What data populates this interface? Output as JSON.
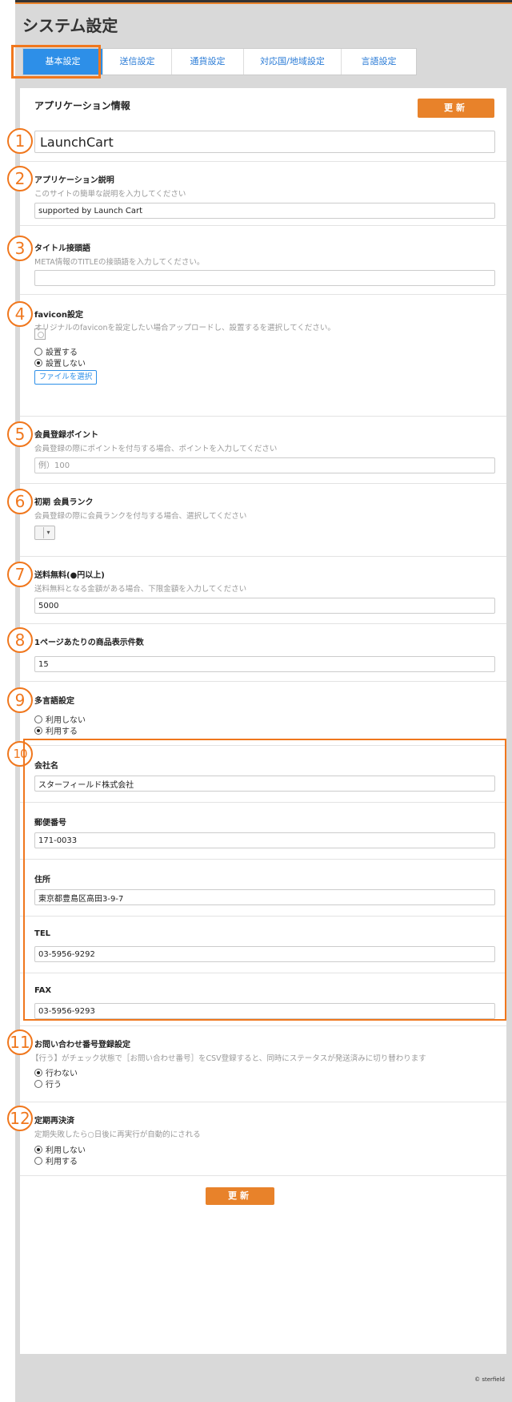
{
  "page_title": "システム設定",
  "tabs": [
    {
      "label": "基本設定",
      "active": true
    },
    {
      "label": "送信設定"
    },
    {
      "label": "通貨設定"
    },
    {
      "label": "対応国/地域設定"
    },
    {
      "label": "言語設定"
    }
  ],
  "panel_title": "アプリケーション情報",
  "update_label": "更新",
  "markers": [
    "1",
    "2",
    "3",
    "4",
    "5",
    "6",
    "7",
    "8",
    "9",
    "10",
    "11",
    "12"
  ],
  "fields": {
    "app_name": {
      "value": "LaunchCart"
    },
    "app_desc": {
      "label": "アプリケーション説明",
      "help": "このサイトの簡単な説明を入力してください",
      "value": "supported by Launch Cart"
    },
    "title_prefix": {
      "label": "タイトル接頭語",
      "help": "META情報のTITLEの接頭語を入力してください。",
      "value": ""
    },
    "favicon": {
      "label": "favicon設定",
      "help": "オリジナルのfaviconを設定したい場合アップロードし、設置するを選択してください。",
      "options": [
        "設置する",
        "設置しない"
      ],
      "selected": "設置しない",
      "file_button": "ファイルを選択"
    },
    "signup_point": {
      "label": "会員登録ポイント",
      "help": "会員登録の際にポイントを付与する場合、ポイントを入力してください",
      "placeholder": "例）100"
    },
    "initial_rank": {
      "label": "初期 会員ランク",
      "help": "会員登録の際に会員ランクを付与する場合、選択してください",
      "value": ""
    },
    "free_shipping": {
      "label": "送料無料(●円以上)",
      "help": "送料無料となる金額がある場合、下限金額を入力してください",
      "value": "5000"
    },
    "items_per_page": {
      "label": "1ページあたりの商品表示件数",
      "value": "15"
    },
    "multilang": {
      "label": "多言語設定",
      "options": [
        "利用しない",
        "利用する"
      ],
      "selected": "利用する"
    },
    "company": {
      "label": "会社名",
      "value": "スターフィールド株式会社"
    },
    "postal": {
      "label": "郵便番号",
      "value": "171-0033"
    },
    "address": {
      "label": "住所",
      "value": "東京都豊島区高田3-9-7"
    },
    "tel": {
      "label": "TEL",
      "value": "03-5956-9292"
    },
    "fax": {
      "label": "FAX",
      "value": "03-5956-9293"
    },
    "inquiry_no": {
      "label": "お問い合わせ番号登録設定",
      "help": "【行う】がチェック状態で［お問い合わせ番号］をCSV登録すると、同時にステータスが発送済みに切り替わります",
      "options": [
        "行わない",
        "行う"
      ],
      "selected": "行わない"
    },
    "recurring": {
      "label": "定期再決済",
      "help": "定期失敗したら○日後に再実行が自動的にされる",
      "options": [
        "利用しない",
        "利用する"
      ],
      "selected": "利用しない"
    }
  },
  "copyright": "© sterfield",
  "colors": {
    "accent": "#e8822a",
    "tab_active": "#2d8fe8",
    "marker": "#f0771d"
  }
}
